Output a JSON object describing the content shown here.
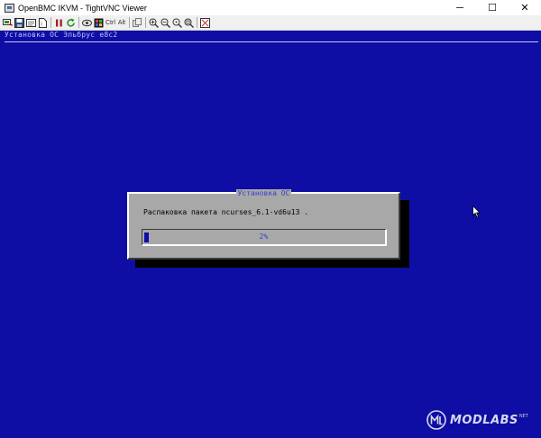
{
  "window": {
    "title": "OpenBMC IKVM - TightVNC Viewer",
    "controls": {
      "minimize": "─",
      "maximize": "☐",
      "close": "✕"
    }
  },
  "toolbar": {
    "ctrl_label": "Ctrl",
    "alt_label": "Alt"
  },
  "console": {
    "header": "Установка ОС Эльбрус e8c2"
  },
  "dialog": {
    "title": "Установка ОС",
    "message": "Распаковка пакета ncurses_6.1-vd6u13 .",
    "progress_label": "2%",
    "progress_fraction": 0.02
  },
  "watermark": {
    "text": "MODLABS",
    "suffix": "NET"
  },
  "colors": {
    "console_bg": "#0e0ea4",
    "dialog_bg": "#a8a8a8",
    "dialog_title": "#3a3ad0"
  }
}
